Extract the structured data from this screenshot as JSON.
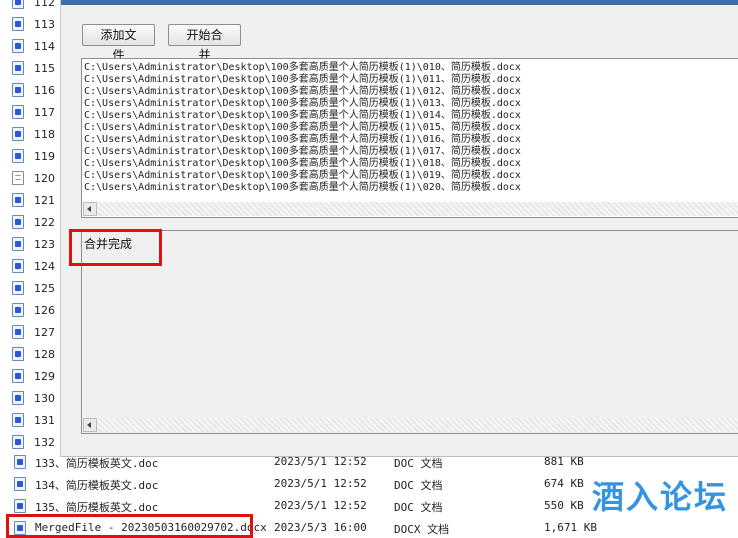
{
  "left_list": {
    "items": [
      {
        "num": "112",
        "icon": "word-doc-icon"
      },
      {
        "num": "113",
        "icon": "word-doc-icon"
      },
      {
        "num": "114",
        "icon": "word-doc-icon"
      },
      {
        "num": "115",
        "icon": "word-doc-icon"
      },
      {
        "num": "116",
        "icon": "word-doc-icon"
      },
      {
        "num": "117",
        "icon": "word-doc-icon"
      },
      {
        "num": "118",
        "icon": "word-doc-icon"
      },
      {
        "num": "119",
        "icon": "word-doc-icon"
      },
      {
        "num": "120",
        "icon": "text-doc-icon"
      },
      {
        "num": "121",
        "icon": "word-doc-icon"
      },
      {
        "num": "122",
        "icon": "word-doc-icon"
      },
      {
        "num": "123",
        "icon": "word-doc-icon"
      },
      {
        "num": "124",
        "icon": "word-doc-icon"
      },
      {
        "num": "125",
        "icon": "word-doc-icon"
      },
      {
        "num": "126",
        "icon": "word-doc-icon"
      },
      {
        "num": "127",
        "icon": "word-doc-icon"
      },
      {
        "num": "128",
        "icon": "word-doc-icon"
      },
      {
        "num": "129",
        "icon": "word-doc-icon"
      },
      {
        "num": "130",
        "icon": "word-doc-icon"
      },
      {
        "num": "131",
        "icon": "word-doc-icon"
      },
      {
        "num": "132",
        "icon": "word-doc-icon"
      }
    ]
  },
  "dialog": {
    "add_button": "添加文件",
    "start_button": "开始合并",
    "file_paths": [
      "C:\\Users\\Administrator\\Desktop\\100多套高质量个人简历模板(1)\\010、简历模板.docx",
      "C:\\Users\\Administrator\\Desktop\\100多套高质量个人简历模板(1)\\011、简历模板.docx",
      "C:\\Users\\Administrator\\Desktop\\100多套高质量个人简历模板(1)\\012、简历模板.docx",
      "C:\\Users\\Administrator\\Desktop\\100多套高质量个人简历模板(1)\\013、简历模板.docx",
      "C:\\Users\\Administrator\\Desktop\\100多套高质量个人简历模板(1)\\014、简历模板.docx",
      "C:\\Users\\Administrator\\Desktop\\100多套高质量个人简历模板(1)\\015、简历模板.docx",
      "C:\\Users\\Administrator\\Desktop\\100多套高质量个人简历模板(1)\\016、简历模板.docx",
      "C:\\Users\\Administrator\\Desktop\\100多套高质量个人简历模板(1)\\017、简历模板.docx",
      "C:\\Users\\Administrator\\Desktop\\100多套高质量个人简历模板(1)\\018、简历模板.docx",
      "C:\\Users\\Administrator\\Desktop\\100多套高质量个人简历模板(1)\\019、简历模板.docx",
      "C:\\Users\\Administrator\\Desktop\\100多套高质量个人简历模板(1)\\020、简历模板.docx"
    ],
    "log_text": "合并完成"
  },
  "file_rows": [
    {
      "name": "133、简历模板英文.doc",
      "date": "2023/5/1 12:52",
      "type": "DOC 文档",
      "size": "881 KB"
    },
    {
      "name": "134、简历模板英文.doc",
      "date": "2023/5/1 12:52",
      "type": "DOC 文档",
      "size": "674 KB"
    },
    {
      "name": "135、简历模板英文.doc",
      "date": "2023/5/1 12:52",
      "type": "DOC 文档",
      "size": "550 KB"
    },
    {
      "name": "MergedFile - 20230503160029702.docx",
      "date": "2023/5/3 16:00",
      "type": "DOCX 文档",
      "size": "1,671 KB"
    }
  ],
  "watermark": "酒入论坛",
  "colors": {
    "highlight": "#e01010",
    "dialog_bg": "#f0f0f0",
    "watermark": "#2a8fe0"
  }
}
